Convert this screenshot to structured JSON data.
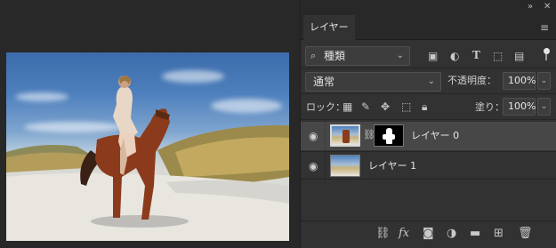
{
  "panel": {
    "collapse_icon": "double-chevron-right",
    "close_icon": "close-x",
    "tab_label": "レイヤー",
    "menu_icon": "hamburger"
  },
  "filter": {
    "kind_label": "種類",
    "search_icon": "search-magnifier",
    "filter_icons": [
      "image-filter",
      "adjustment-filter",
      "type-filter",
      "shape-filter",
      "smart-object-filter"
    ],
    "toggle_state": "on"
  },
  "blend": {
    "mode": "通常",
    "opacity_label": "不透明度：",
    "opacity_value": "100%"
  },
  "lock": {
    "label": "ロック：",
    "icons": [
      "lock-transparent-pixels",
      "lock-image-pixels",
      "lock-position",
      "lock-artboard",
      "lock-all"
    ],
    "fill_label": "塗り：",
    "fill_value": "100%"
  },
  "layers": [
    {
      "name": "レイヤー 0",
      "visible": true,
      "selected": true,
      "has_mask": true
    },
    {
      "name": "レイヤー 1",
      "visible": true,
      "selected": false,
      "has_mask": false
    }
  ],
  "bottom_icons": [
    "link-layers",
    "fx",
    "add-mask",
    "new-adjustment",
    "new-group",
    "new-layer",
    "delete-layer"
  ],
  "bottom_labels": {
    "fx": "fx"
  },
  "colors": {
    "panel_bg": "#323232",
    "selected_row": "#474747",
    "app_bg": "#282828"
  }
}
